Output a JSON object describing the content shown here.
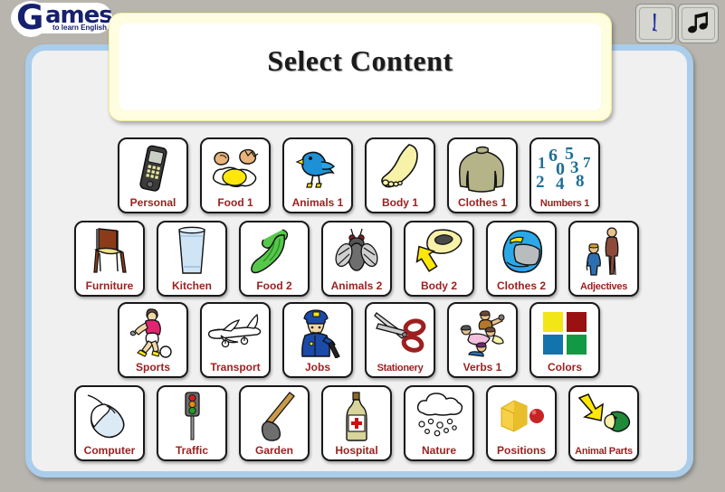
{
  "logo": {
    "main_letter": "G",
    "main_rest": "ames",
    "tagline": "to learn English",
    "name": "games-to-learn-english-logo"
  },
  "toolbar": {
    "buttons": [
      {
        "name": "sound-button",
        "icon": "sound-wave-icon",
        "label": ""
      },
      {
        "name": "music-button",
        "icon": "music-note-icon",
        "label": ""
      }
    ]
  },
  "header": {
    "title": "Select Content"
  },
  "colors": {
    "page_background": "#b7b5ae",
    "frame_border": "#aacdeb",
    "panel_background": "#f0f0f0",
    "title_panel": "#fffde0",
    "label_text": "#9d1f1f",
    "logo_blue": "#16206e"
  },
  "grid": {
    "rows": [
      {
        "items": [
          {
            "label": "Personal",
            "icon": "mobile-phone-icon"
          },
          {
            "label": "Food 1",
            "icon": "fried-egg-icon"
          },
          {
            "label": "Animals 1",
            "icon": "blue-bird-icon"
          },
          {
            "label": "Body 1",
            "icon": "foot-icon"
          },
          {
            "label": "Clothes 1",
            "icon": "sweater-icon"
          },
          {
            "label": "Numbers 1",
            "icon": "numbers-icon"
          }
        ]
      },
      {
        "items": [
          {
            "label": "Furniture",
            "icon": "chair-icon"
          },
          {
            "label": "Kitchen",
            "icon": "glass-of-water-icon"
          },
          {
            "label": "Food 2",
            "icon": "celery-icon"
          },
          {
            "label": "Animals 2",
            "icon": "fly-icon"
          },
          {
            "label": "Body 2",
            "icon": "mouth-moustache-icon"
          },
          {
            "label": "Clothes 2",
            "icon": "helmet-icon"
          },
          {
            "label": "Adjectives",
            "icon": "tall-short-people-icon"
          }
        ]
      },
      {
        "items": [
          {
            "label": "Sports",
            "icon": "soccer-player-icon"
          },
          {
            "label": "Transport",
            "icon": "airplane-icon"
          },
          {
            "label": "Jobs",
            "icon": "policeman-icon"
          },
          {
            "label": "Stationery",
            "icon": "scissors-icon"
          },
          {
            "label": "Verbs 1",
            "icon": "people-actions-icon"
          },
          {
            "label": "Colors",
            "icon": "color-swatches-icon"
          }
        ]
      },
      {
        "items": [
          {
            "label": "Computer",
            "icon": "computer-mouse-icon"
          },
          {
            "label": "Traffic",
            "icon": "traffic-light-icon"
          },
          {
            "label": "Garden",
            "icon": "spade-icon"
          },
          {
            "label": "Hospital",
            "icon": "medicine-bottle-icon"
          },
          {
            "label": "Nature",
            "icon": "rain-cloud-icon"
          },
          {
            "label": "Positions",
            "icon": "cube-and-ball-icon"
          },
          {
            "label": "Animal Parts",
            "icon": "arrow-parrot-beak-icon"
          }
        ]
      }
    ]
  },
  "numbers_icon": {
    "digits": [
      "1",
      "6",
      "5",
      "7",
      "0",
      "3",
      "2",
      "4",
      "8"
    ]
  },
  "colors_icon": {
    "swatches": [
      "#f2e616",
      "#991111",
      "#1273ad",
      "#119944"
    ]
  }
}
